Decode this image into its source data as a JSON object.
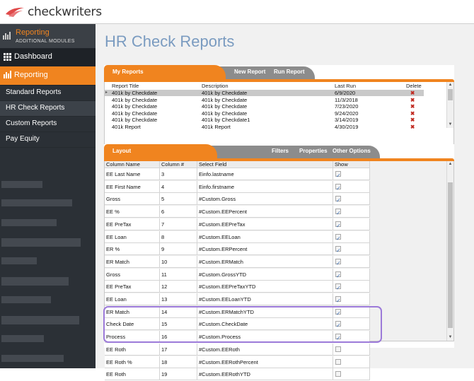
{
  "app": {
    "logo_text": "checkwriters",
    "brand_color": "#e04a4a"
  },
  "sidebar": {
    "module_title": "Reporting",
    "module_subtitle": "ADDITIONAL MODULES",
    "items": [
      {
        "label": "Dashboard",
        "icon": "grid-icon"
      },
      {
        "label": "Reporting",
        "icon": "chart-icon",
        "active": true
      }
    ],
    "subitems": [
      {
        "label": "Standard Reports"
      },
      {
        "label": "HR Check Reports",
        "active": true
      },
      {
        "label": "Custom Reports"
      },
      {
        "label": "Pay Equity"
      }
    ]
  },
  "page": {
    "title": "HR Check Reports"
  },
  "reports_panel": {
    "tab_active": "My Reports",
    "tab_new": "New Report",
    "tab_run": "Run Report",
    "columns": [
      "Report Title",
      "Description",
      "Last Run",
      "Delete"
    ],
    "rows": [
      {
        "title": "401k by Checkdate",
        "description": "401k by Checkdate",
        "last_run": "6/9/2020",
        "selected": true
      },
      {
        "title": "401k by Checkdate",
        "description": "401k by Checkdate",
        "last_run": "11/3/2018"
      },
      {
        "title": "401k by Checkdate",
        "description": "401k by Checkdate",
        "last_run": "7/23/2020"
      },
      {
        "title": "401k by Checkdate",
        "description": "401k by Checkdate",
        "last_run": "9/24/2020"
      },
      {
        "title": "401k by Checkdate",
        "description": "401k by Checkdate1",
        "last_run": "3/14/2019"
      },
      {
        "title": "401k Report",
        "description": "401k Report",
        "last_run": "4/30/2019"
      }
    ]
  },
  "layout_panel": {
    "tab_active": "Layout",
    "tab_filters": "Filters",
    "tab_properties": "Properties",
    "tab_other": "Other Options",
    "columns": [
      "Column Name",
      "Column #",
      "Select Field",
      "Show"
    ],
    "rows": [
      {
        "name": "EE Last Name",
        "num": "3",
        "field": "Einfo.lastname",
        "show": true
      },
      {
        "name": "EE First Name",
        "num": "4",
        "field": "Einfo.firstname",
        "show": true
      },
      {
        "name": "Gross",
        "num": "5",
        "field": "#Custom.Gross",
        "show": true
      },
      {
        "name": "EE %",
        "num": "6",
        "field": "#Custom.EEPercent",
        "show": true
      },
      {
        "name": "EE PreTax",
        "num": "7",
        "field": "#Custom.EEPreTax",
        "show": true
      },
      {
        "name": "EE Loan",
        "num": "8",
        "field": "#Custom.EELoan",
        "show": true
      },
      {
        "name": "ER %",
        "num": "9",
        "field": "#Custom.ERPercent",
        "show": true
      },
      {
        "name": "ER Match",
        "num": "10",
        "field": "#Custom.ERMatch",
        "show": true
      },
      {
        "name": "Gross",
        "num": "11",
        "field": "#Custom.GrossYTD",
        "show": true
      },
      {
        "name": "EE PreTax",
        "num": "12",
        "field": "#Custom.EEPreTaxYTD",
        "show": true
      },
      {
        "name": "EE Loan",
        "num": "13",
        "field": "#Custom.EELoanYTD",
        "show": true
      },
      {
        "name": "ER Match",
        "num": "14",
        "field": "#Custom.ERMatchYTD",
        "show": true
      },
      {
        "name": "Check Date",
        "num": "15",
        "field": "#Custom.CheckDate",
        "show": true
      },
      {
        "name": "Process",
        "num": "16",
        "field": "#Custom.Process",
        "show": true
      },
      {
        "name": "EE Roth",
        "num": "17",
        "field": "#Custom.EERoth",
        "show": false
      },
      {
        "name": "EE Roth %",
        "num": "18",
        "field": "#Custom.EERothPercent",
        "show": false
      },
      {
        "name": "EE Roth",
        "num": "19",
        "field": "#Custom.EERothYTD",
        "show": false
      }
    ]
  },
  "colors": {
    "accent": "#f0841f",
    "sidebar": "#2b3036",
    "title": "#7a9bc0",
    "highlight": "#9c7ad9",
    "delete": "#c0281f"
  }
}
